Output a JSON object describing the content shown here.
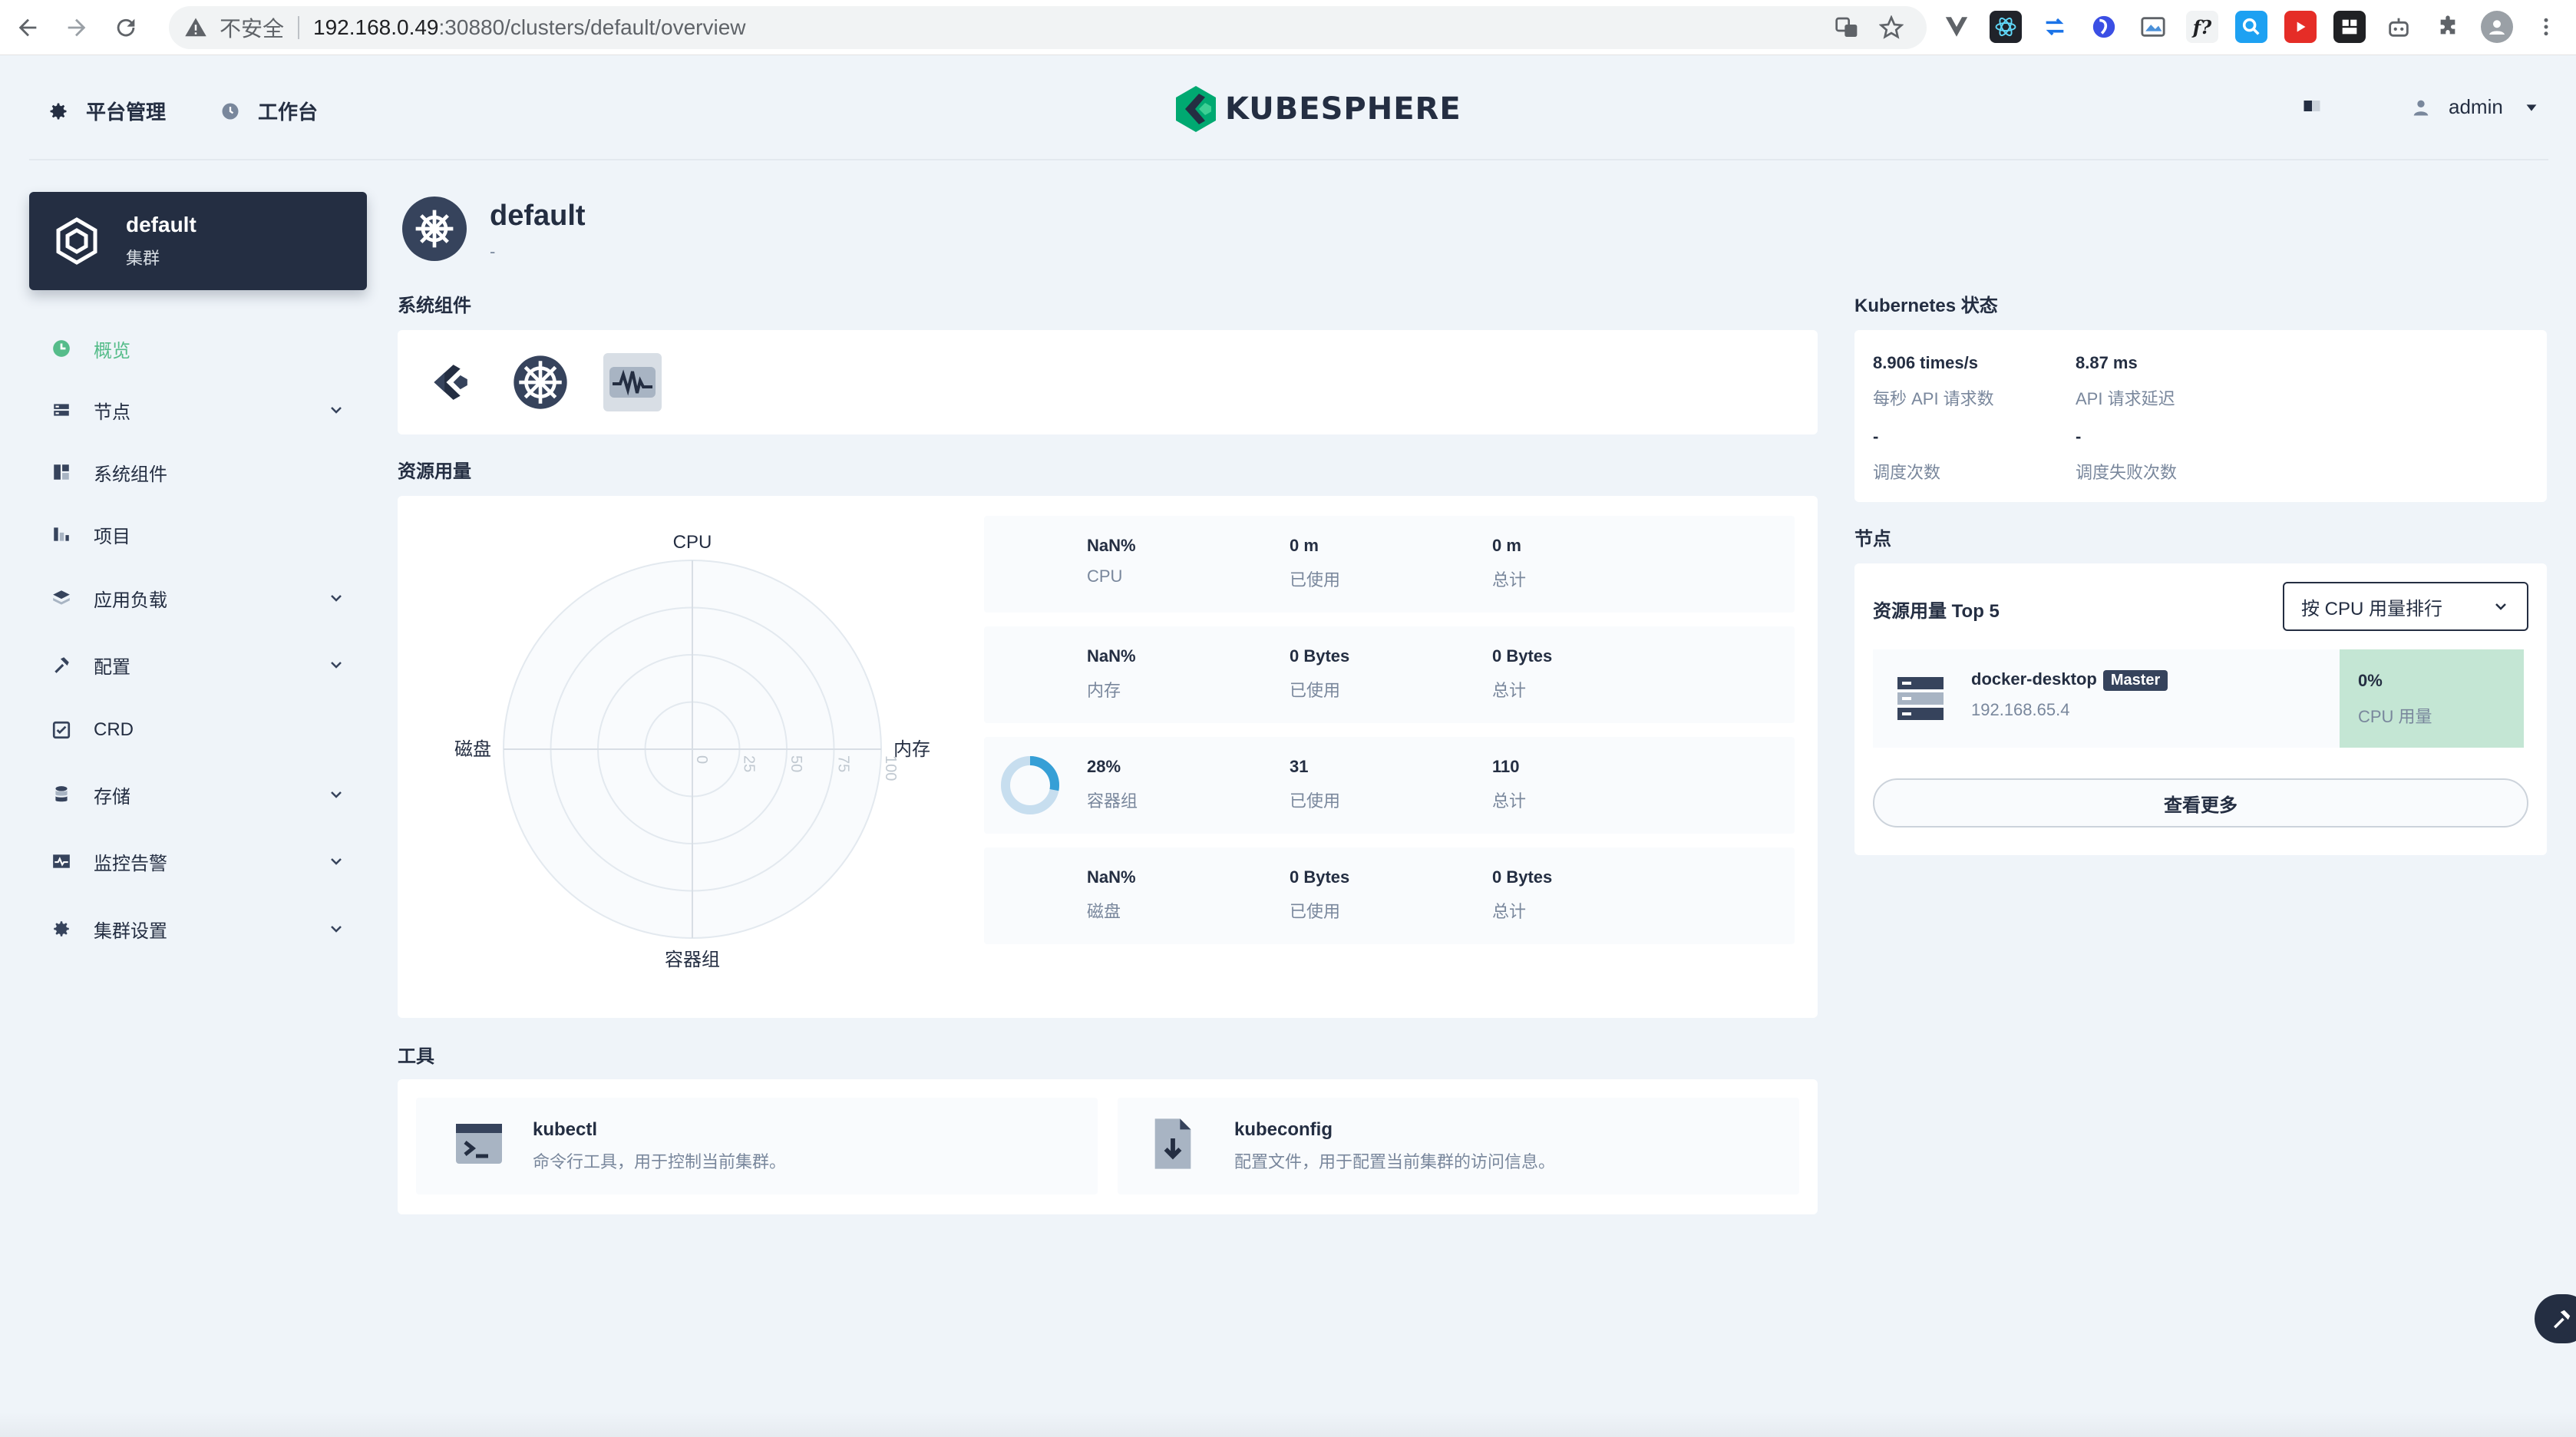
{
  "browser": {
    "insecure_label": "不安全",
    "url_host": "192.168.0.49",
    "url_path": ":30880/clusters/default/overview"
  },
  "header": {
    "platform_label": "平台管理",
    "workbench_label": "工作台",
    "logo_text": "KUBESPHERE",
    "user_name": "admin"
  },
  "cluster": {
    "name": "default",
    "type": "集群"
  },
  "sidebar": {
    "items": [
      {
        "label": "概览"
      },
      {
        "label": "节点"
      },
      {
        "label": "系统组件"
      },
      {
        "label": "项目"
      },
      {
        "label": "应用负载"
      },
      {
        "label": "配置"
      },
      {
        "label": "CRD"
      },
      {
        "label": "存储"
      },
      {
        "label": "监控告警"
      },
      {
        "label": "集群设置"
      }
    ]
  },
  "page": {
    "title": "default",
    "subtitle": "-"
  },
  "sections": {
    "system_components": "系统组件",
    "resource_usage": "资源用量",
    "tools": "工具",
    "k8s_status": "Kubernetes 状态",
    "nodes": "节点"
  },
  "radar": {
    "axes": [
      "CPU",
      "内存",
      "容器组",
      "磁盘"
    ],
    "ticks": [
      "0",
      "25",
      "50",
      "75",
      "100"
    ]
  },
  "resources": [
    {
      "usage": "NaN%",
      "name": "CPU",
      "used": "0 m",
      "used_label": "已使用",
      "total": "0 m",
      "total_label": "总计"
    },
    {
      "usage": "NaN%",
      "name": "内存",
      "used": "0 Bytes",
      "used_label": "已使用",
      "total": "0 Bytes",
      "total_label": "总计"
    },
    {
      "usage": "28%",
      "name": "容器组",
      "used": "31",
      "used_label": "已使用",
      "total": "110",
      "total_label": "总计",
      "fraction": 0.28
    },
    {
      "usage": "NaN%",
      "name": "磁盘",
      "used": "0 Bytes",
      "used_label": "已使用",
      "total": "0 Bytes",
      "total_label": "总计"
    }
  ],
  "k8s": {
    "api_rate": "8.906 times/s",
    "api_rate_label": "每秒 API 请求数",
    "api_latency": "8.87 ms",
    "api_latency_label": "API 请求延迟",
    "schedule_count": "-",
    "schedule_count_label": "调度次数",
    "schedule_fail": "-",
    "schedule_fail_label": "调度失败次数"
  },
  "nodes": {
    "top_label": "资源用量 Top 5",
    "sort_label": "按 CPU 用量排行",
    "list": [
      {
        "name": "docker-desktop",
        "role": "Master",
        "ip": "192.168.65.4",
        "metric_value": "0%",
        "metric_label": "CPU 用量"
      }
    ],
    "see_more": "查看更多"
  },
  "tools": [
    {
      "name": "kubectl",
      "desc": "命令行工具，用于控制当前集群。"
    },
    {
      "name": "kubeconfig",
      "desc": "配置文件，用于配置当前集群的访问信息。"
    }
  ],
  "colors": {
    "accent": "#55bc8a",
    "dark": "#242e42",
    "pod_ring": "#369fd6",
    "pod_ring_bg": "#c7deef"
  }
}
